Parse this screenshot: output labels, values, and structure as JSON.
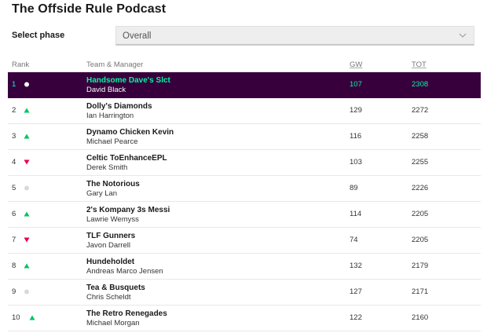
{
  "page": {
    "title": "The Offside Rule Podcast"
  },
  "phase": {
    "label": "Select phase",
    "selected": "Overall"
  },
  "table": {
    "headers": {
      "rank": "Rank",
      "team": "Team & Manager",
      "gw": "GW",
      "tot": "TOT"
    },
    "rows": [
      {
        "rank": "1",
        "movement": "same",
        "team": "Handsome Dave's Slct",
        "manager": "David Black",
        "gw": "107",
        "tot": "2308"
      },
      {
        "rank": "2",
        "movement": "up",
        "team": "Dolly's Diamonds",
        "manager": "Ian Harrington",
        "gw": "129",
        "tot": "2272"
      },
      {
        "rank": "3",
        "movement": "up",
        "team": "Dynamo Chicken Kevin",
        "manager": "Michael Pearce",
        "gw": "116",
        "tot": "2258"
      },
      {
        "rank": "4",
        "movement": "down",
        "team": "Celtic ToEnhanceEPL",
        "manager": "Derek Smith",
        "gw": "103",
        "tot": "2255"
      },
      {
        "rank": "5",
        "movement": "same",
        "team": "The Notorious",
        "manager": "Gary Lan",
        "gw": "89",
        "tot": "2226"
      },
      {
        "rank": "6",
        "movement": "up",
        "team": "2's Kompany 3s Messi",
        "manager": "Lawrie Wemyss",
        "gw": "114",
        "tot": "2205"
      },
      {
        "rank": "7",
        "movement": "down",
        "team": "TLF Gunners",
        "manager": "Javon Darrell",
        "gw": "74",
        "tot": "2205"
      },
      {
        "rank": "8",
        "movement": "up",
        "team": "Hundeholdet",
        "manager": "Andreas Marco Jensen",
        "gw": "132",
        "tot": "2179"
      },
      {
        "rank": "9",
        "movement": "same",
        "team": "Tea & Busquets",
        "manager": "Chris Scheldt",
        "gw": "127",
        "tot": "2171"
      },
      {
        "rank": "10",
        "movement": "up",
        "team": "The Retro Renegades",
        "manager": "Michael Morgan",
        "gw": "122",
        "tot": "2160"
      }
    ]
  },
  "colors": {
    "row_highlight": "#37003c",
    "highlight_text": "#04f5a0",
    "up": "#00c45e",
    "down": "#e90052",
    "same": "#d9d9d9",
    "same_selected": "#ffffff"
  }
}
